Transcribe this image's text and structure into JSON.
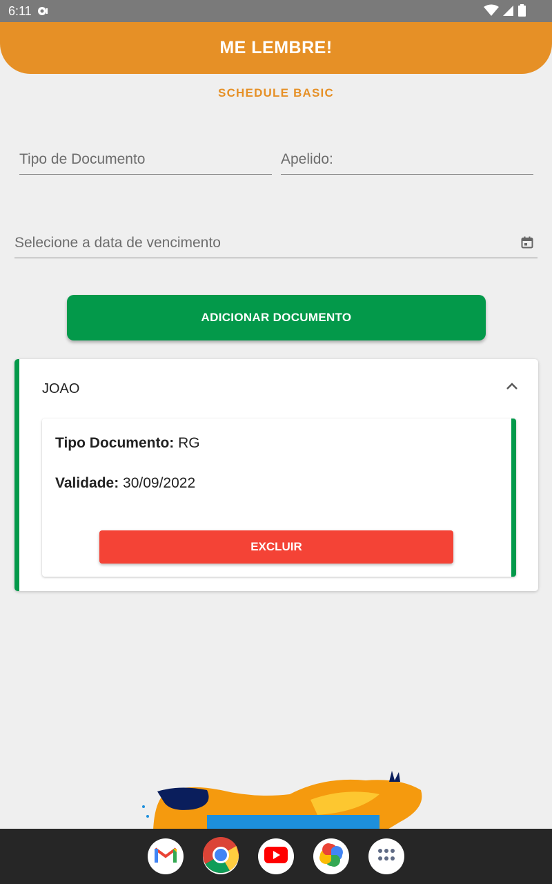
{
  "status": {
    "time": "6:11"
  },
  "app": {
    "title": "ME LEMBRE!",
    "subtitle": "SCHEDULE BASIC"
  },
  "form": {
    "tipo_placeholder": "Tipo de Documento",
    "apelido_placeholder": "Apelido:",
    "data_placeholder": "Selecione a data de vencimento",
    "add_label": "ADICIONAR DOCUMENTO"
  },
  "card": {
    "title": "JOAO",
    "tipo_label": "Tipo Documento:",
    "tipo_value": "RG",
    "validade_label": "Validade:",
    "validade_value": "30/09/2022",
    "delete_label": "EXCLUIR"
  },
  "colors": {
    "accent": "#e69026",
    "green": "#03994a",
    "red": "#f44336",
    "background": "#efefef"
  },
  "dock": [
    "gmail-icon",
    "chrome-icon",
    "youtube-icon",
    "photos-icon",
    "app-drawer-icon"
  ]
}
